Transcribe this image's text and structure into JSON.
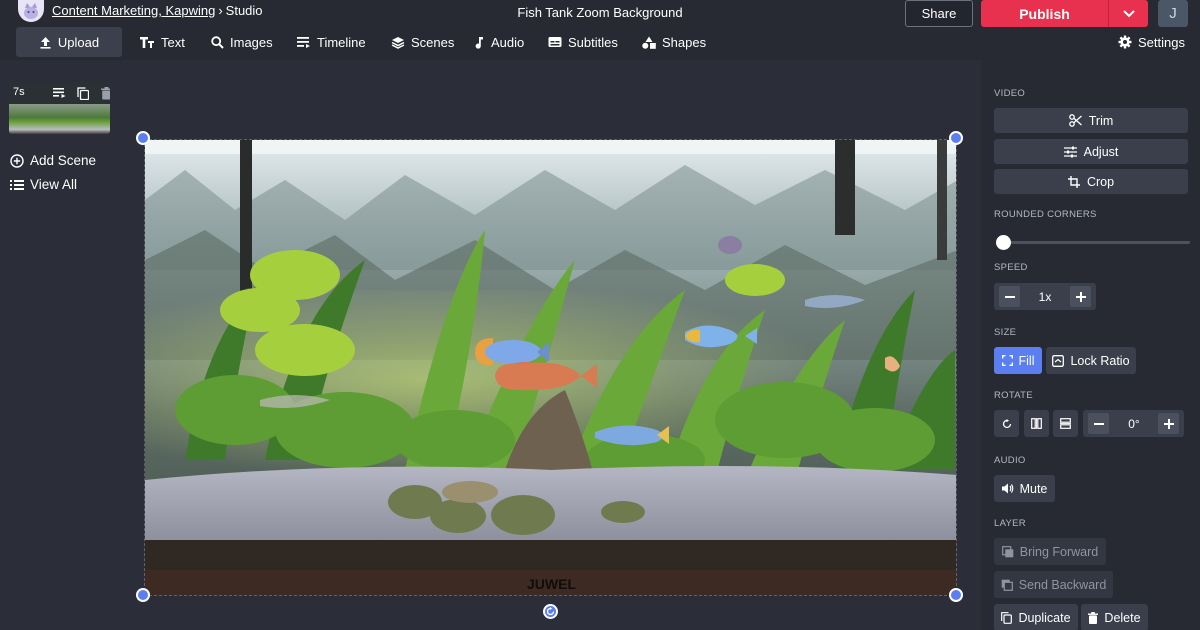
{
  "breadcrumb": {
    "workspace": "Content Marketing, Kapwing",
    "page": "Studio",
    "separator": "›"
  },
  "document_title": "Fish Tank Zoom Background",
  "header": {
    "share_label": "Share",
    "publish_label": "Publish",
    "user_initial": "J"
  },
  "toolbar": {
    "upload": "Upload",
    "text": "Text",
    "images": "Images",
    "timeline": "Timeline",
    "scenes": "Scenes",
    "audio": "Audio",
    "subtitles": "Subtitles",
    "shapes": "Shapes",
    "settings": "Settings"
  },
  "scenes": {
    "duration": "7s",
    "add_scene": "Add Scene",
    "view_all": "View All"
  },
  "canvas": {
    "tank_brand": "JUWEL"
  },
  "panel": {
    "video_label": "VIDEO",
    "trim": "Trim",
    "adjust": "Adjust",
    "crop": "Crop",
    "rounded_corners_label": "ROUNDED CORNERS",
    "rounded_corners_value": 0,
    "speed_label": "SPEED",
    "speed_value": "1x",
    "size_label": "SIZE",
    "fill": "Fill",
    "lock_ratio": "Lock Ratio",
    "rotate_label": "ROTATE",
    "rotate_value": "0°",
    "audio_label": "AUDIO",
    "mute": "Mute",
    "layer_label": "LAYER",
    "bring_forward": "Bring Forward",
    "send_backward": "Send Backward",
    "duplicate": "Duplicate",
    "delete": "Delete"
  },
  "colors": {
    "accent": "#5b7ef0",
    "publish": "#e8304f",
    "panel_bg": "#272a33",
    "workspace_bg": "#2b2e38"
  }
}
